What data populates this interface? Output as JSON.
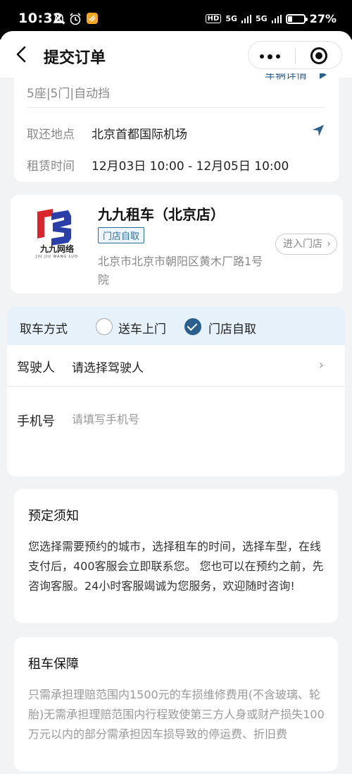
{
  "status_bar": {
    "time": "10:32",
    "network": "HD",
    "signal1": "5G",
    "signal2": "5G",
    "battery": "27%"
  },
  "header": {
    "title": "提交订单"
  },
  "car": {
    "spec": "5座|5门|自动挡",
    "detail_link": "车辆详情",
    "location_label": "取还地点",
    "location_value": "北京首都国际机场",
    "time_label": "租赁时间",
    "time_value": "12月03日 10:00 - 12月05日 10:00"
  },
  "store": {
    "logo_name": "九九网络",
    "logo_sub": "JIU JIU WANG LUO",
    "name": "九九租车（北京店）",
    "tag": "门店自取",
    "enter_label": "进入门店",
    "address": "北京市北京市朝阳区黄木厂路1号院"
  },
  "pickup": {
    "label": "取车方式",
    "options": [
      {
        "label": "送车上门",
        "selected": false
      },
      {
        "label": "门店自取",
        "selected": true
      }
    ],
    "driver_label": "驾驶人",
    "driver_value": "请选择驾驶人",
    "phone_label": "手机号",
    "phone_placeholder": "请填写手机号"
  },
  "notice": {
    "title": "预定须知",
    "body": "您选择需要预约的城市，选择租车的时间，选择车型，在线支付后，400客服会立即联系您。 您也可以在预约之前，先咨询客服。24小时客服竭诚为您服务，欢迎随时咨询!"
  },
  "guarantee": {
    "title": "租车保障",
    "body": "只需承担理赔范围内1500元的车损维修费用(不含玻璃、轮胎)无需承担理赔范围内行程致使第三方人身或财产损失100万元以内的部分需承担因车损导致的停运费、折旧费"
  },
  "colors": {
    "accent": "#2a5f8e",
    "pickup_bar": "#e6f1fa",
    "background": "#f2f3f5"
  }
}
